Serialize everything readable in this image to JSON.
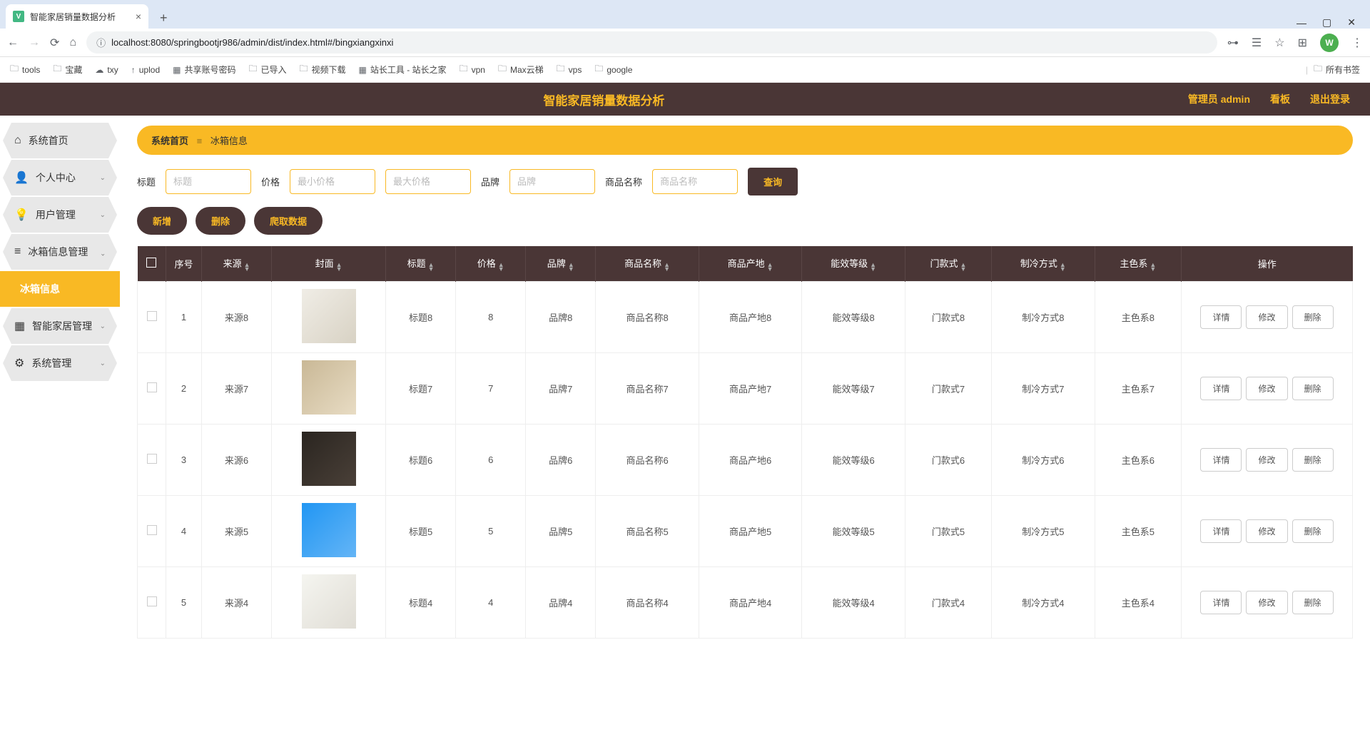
{
  "browser": {
    "tab_title": "智能家居销量数据分析",
    "url": "localhost:8080/springbootjr986/admin/dist/index.html#/bingxiangxinxi",
    "bookmarks": [
      "tools",
      "宝藏",
      "txy",
      "uplod",
      "共享账号密码",
      "已导入",
      "视频下载",
      "站长工具 - 站长之家",
      "vpn",
      "Max云梯",
      "vps",
      "google"
    ],
    "bookmark_right": "所有书签"
  },
  "header": {
    "title": "智能家居销量数据分析",
    "user": "管理员 admin",
    "dashboard": "看板",
    "logout": "退出登录"
  },
  "sidebar": {
    "items": [
      {
        "label": "系统首页"
      },
      {
        "label": "个人中心"
      },
      {
        "label": "用户管理"
      },
      {
        "label": "冰箱信息管理"
      },
      {
        "label": "冰箱信息"
      },
      {
        "label": "智能家居管理"
      },
      {
        "label": "系统管理"
      }
    ]
  },
  "breadcrumb": {
    "home": "系统首页",
    "current": "冰箱信息"
  },
  "search": {
    "title_label": "标题",
    "title_ph": "标题",
    "price_label": "价格",
    "min_price_ph": "最小价格",
    "max_price_ph": "最大价格",
    "brand_label": "品牌",
    "brand_ph": "品牌",
    "product_label": "商品名称",
    "product_ph": "商品名称",
    "query_btn": "查询"
  },
  "actions": {
    "add": "新增",
    "delete": "删除",
    "crawl": "爬取数据"
  },
  "table": {
    "headers": [
      "",
      "序号",
      "来源",
      "封面",
      "标题",
      "价格",
      "品牌",
      "商品名称",
      "商品产地",
      "能效等级",
      "门款式",
      "制冷方式",
      "主色系",
      "操作"
    ],
    "row_buttons": {
      "detail": "详情",
      "edit": "修改",
      "delete": "删除"
    },
    "rows": [
      {
        "seq": "1",
        "src": "来源8",
        "title": "标题8",
        "price": "8",
        "brand": "品牌8",
        "product": "商品名称8",
        "origin": "商品产地8",
        "energy": "能效等级8",
        "door": "门款式8",
        "cool": "制冷方式8",
        "color": "主色系8",
        "thumb": "chair"
      },
      {
        "seq": "2",
        "src": "来源7",
        "title": "标题7",
        "price": "7",
        "brand": "品牌7",
        "product": "商品名称7",
        "origin": "商品产地7",
        "energy": "能效等级7",
        "door": "门款式7",
        "cool": "制冷方式7",
        "color": "主色系7",
        "thumb": "kitchen"
      },
      {
        "seq": "3",
        "src": "来源6",
        "title": "标题6",
        "price": "6",
        "brand": "品牌6",
        "product": "商品名称6",
        "origin": "商品产地6",
        "energy": "能效等级6",
        "door": "门款式6",
        "cool": "制冷方式6",
        "color": "主色系6",
        "thumb": "dark"
      },
      {
        "seq": "4",
        "src": "来源5",
        "title": "标题5",
        "price": "5",
        "brand": "品牌5",
        "product": "商品名称5",
        "origin": "商品产地5",
        "energy": "能效等级5",
        "door": "门款式5",
        "cool": "制冷方式5",
        "color": "主色系5",
        "thumb": "blue"
      },
      {
        "seq": "5",
        "src": "来源4",
        "title": "标题4",
        "price": "4",
        "brand": "品牌4",
        "product": "商品名称4",
        "origin": "商品产地4",
        "energy": "能效等级4",
        "door": "门款式4",
        "cool": "制冷方式4",
        "color": "主色系4",
        "thumb": "light"
      }
    ]
  }
}
